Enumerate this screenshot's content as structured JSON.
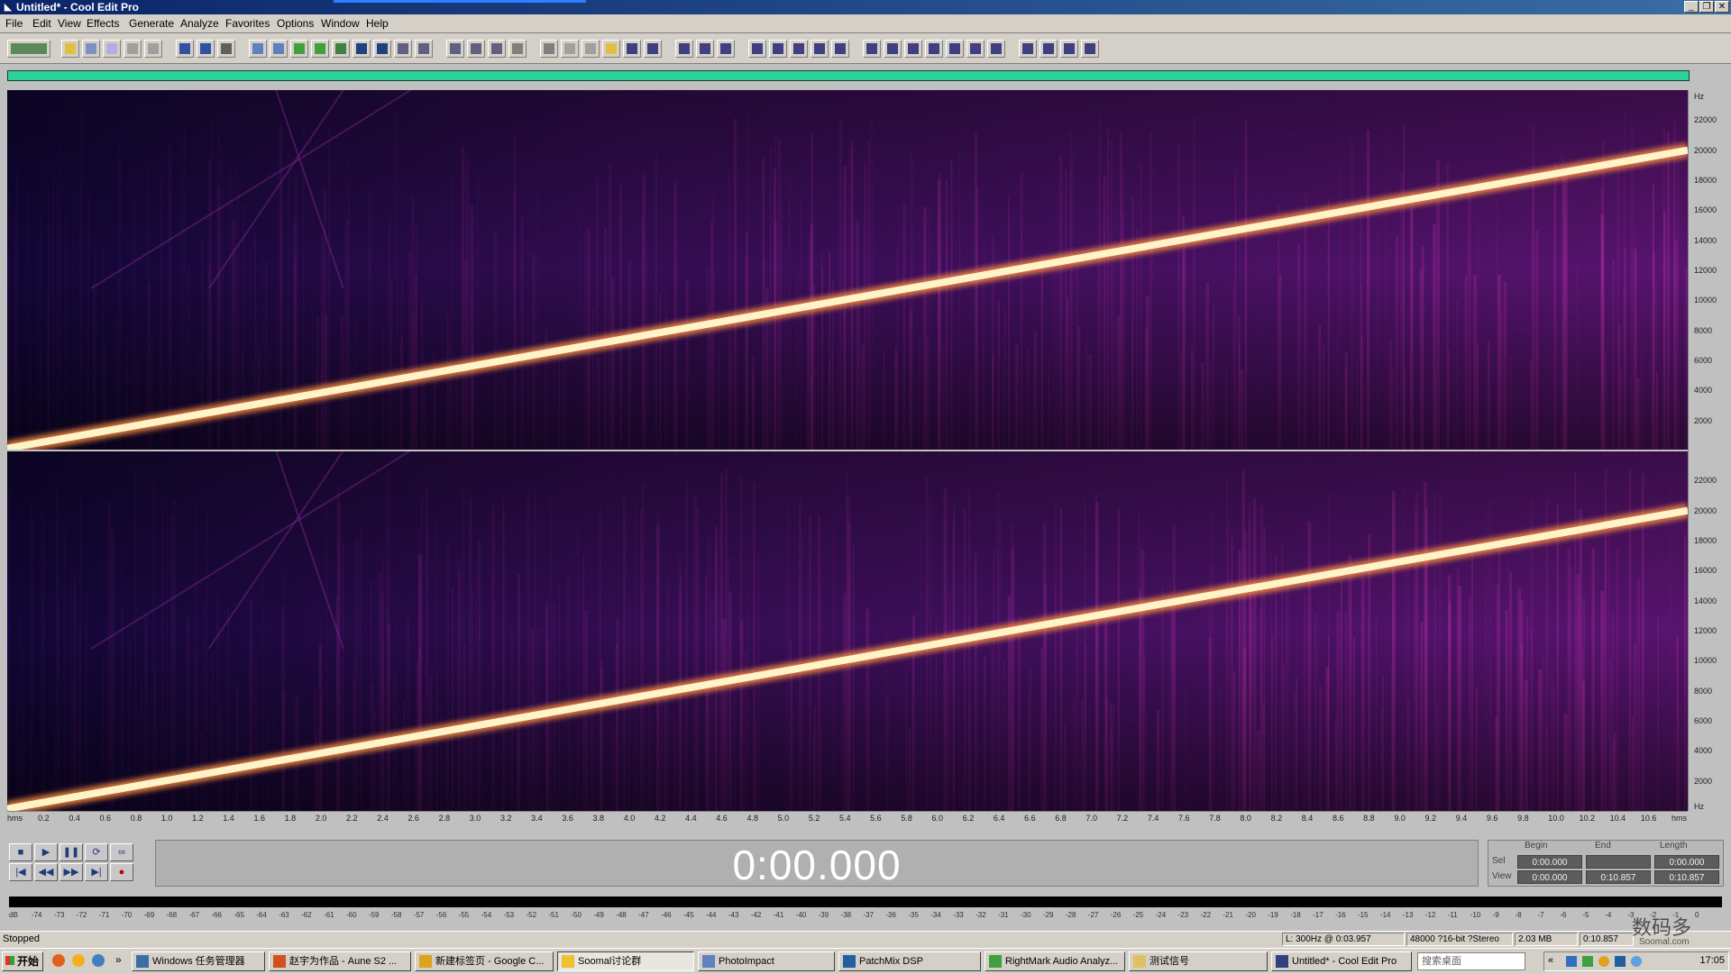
{
  "window": {
    "title": "Untitled* - Cool Edit Pro",
    "minimize": "_",
    "restore": "❐",
    "close": "✕"
  },
  "menu": [
    "File",
    "Edit",
    "View",
    "Effects",
    "Generate",
    "Analyze",
    "Favorites",
    "Options",
    "Window",
    "Help"
  ],
  "toolbar": {
    "buttons": [
      "multitrack-toggle",
      "new",
      "open",
      "save",
      "save-as",
      "close",
      "undo",
      "redo",
      "cut",
      "copy",
      "paste",
      "paste-new",
      "mix-paste",
      "trim",
      "zoom-in",
      "zoom-out",
      "zoom-full",
      "zoom-left",
      "zoom-right",
      "waveform-view",
      "spectral-view",
      "cue-list",
      "play-list",
      "settings",
      "info",
      "help",
      "amplify",
      "envelope",
      "fade",
      "normalize",
      "noise-reduction",
      "delay",
      "echo",
      "reverb",
      "flanger",
      "chorus",
      "filter",
      "eq",
      "pitch",
      "stretch",
      "generate-tone",
      "generate-noise",
      "analyze-frequency",
      "phase",
      "statistics",
      "batch",
      "scripts"
    ]
  },
  "spectrogram": {
    "hz_labels": [
      "Hz",
      "22000",
      "20000",
      "18000",
      "16000",
      "14000",
      "12000",
      "10000",
      "8000",
      "6000",
      "4000",
      "2000"
    ],
    "bottom_hz_labels": [
      "22000",
      "20000",
      "18000",
      "16000",
      "14000",
      "12000",
      "10000",
      "8000",
      "6000",
      "4000",
      "2000",
      "Hz"
    ],
    "sweep_start_hz": 20,
    "sweep_end_hz": 20000,
    "max_hz": 24000,
    "colors": {
      "background": "#0a0530",
      "noise": "#7a1a8a",
      "sweep": "#fff3c8"
    }
  },
  "timeline": {
    "labels": [
      "hms",
      "0.2",
      "0.4",
      "0.6",
      "0.8",
      "1.0",
      "1.2",
      "1.4",
      "1.6",
      "1.8",
      "2.0",
      "2.2",
      "2.4",
      "2.6",
      "2.8",
      "3.0",
      "3.2",
      "3.4",
      "3.6",
      "3.8",
      "4.0",
      "4.2",
      "4.4",
      "4.6",
      "4.8",
      "5.0",
      "5.2",
      "5.4",
      "5.6",
      "5.8",
      "6.0",
      "6.2",
      "6.4",
      "6.6",
      "6.8",
      "7.0",
      "7.2",
      "7.4",
      "7.6",
      "7.8",
      "8.0",
      "8.2",
      "8.4",
      "8.6",
      "8.8",
      "9.0",
      "9.2",
      "9.4",
      "9.6",
      "9.8",
      "10.0",
      "10.2",
      "10.4",
      "10.6",
      "hms"
    ]
  },
  "transport": {
    "row1": [
      "■",
      "▶",
      "❚❚",
      "⟳",
      "∞"
    ],
    "row2": [
      "|◀",
      "◀◀",
      "▶▶",
      "▶|",
      "●"
    ]
  },
  "time_display": "0:00.000",
  "selection_panel": {
    "headers": [
      "Begin",
      "End",
      "Length"
    ],
    "sel_label": "Sel",
    "view_label": "View",
    "sel": [
      "0:00.000",
      "",
      "0:00.000"
    ],
    "view": [
      "0:00.000",
      "0:10.857",
      "0:10.857"
    ]
  },
  "level_meter": {
    "labels": [
      "dB",
      "-74",
      "-73",
      "-72",
      "-71",
      "-70",
      "-69",
      "-68",
      "-67",
      "-66",
      "-65",
      "-64",
      "-63",
      "-62",
      "-61",
      "-60",
      "-59",
      "-58",
      "-57",
      "-56",
      "-55",
      "-54",
      "-53",
      "-52",
      "-51",
      "-50",
      "-49",
      "-48",
      "-47",
      "-46",
      "-45",
      "-44",
      "-43",
      "-42",
      "-41",
      "-40",
      "-39",
      "-38",
      "-37",
      "-36",
      "-35",
      "-34",
      "-33",
      "-32",
      "-31",
      "-30",
      "-29",
      "-28",
      "-27",
      "-26",
      "-25",
      "-24",
      "-23",
      "-22",
      "-21",
      "-20",
      "-19",
      "-18",
      "-17",
      "-16",
      "-15",
      "-14",
      "-13",
      "-12",
      "-11",
      "-10",
      "-9",
      "-8",
      "-7",
      "-6",
      "-5",
      "-4",
      "-3",
      "-2",
      "-1",
      "0"
    ]
  },
  "status": {
    "text": "Stopped",
    "fields": [
      "L: 300Hz @  0:03.957",
      "48000 ?16-bit ?Stereo",
      "2.03 MB",
      "0:10.857"
    ]
  },
  "taskbar": {
    "start": "开始",
    "tasks": [
      {
        "label": "Windows 任务管理器",
        "color": "#3a6ea5"
      },
      {
        "label": "赵宇为作品 - Aune S2 ...",
        "color": "#d05020"
      },
      {
        "label": "新建标签页 - Google C...",
        "color": "#e0a020"
      },
      {
        "label": "Soomal讨论群",
        "color": "#f0c030"
      },
      {
        "label": "PhotoImpact",
        "color": "#6080c0"
      },
      {
        "label": "PatchMix DSP",
        "color": "#2060a0"
      },
      {
        "label": "RightMark Audio Analyz...",
        "color": "#40a040"
      },
      {
        "label": "测试信号",
        "color": "#e0c060"
      },
      {
        "label": "Untitled* - Cool Edit Pro",
        "color": "#304080"
      }
    ],
    "search_placeholder": "搜索桌面",
    "clock": "17:05"
  },
  "watermark": {
    "text": "数码多",
    "sub": "Soomal.com"
  }
}
